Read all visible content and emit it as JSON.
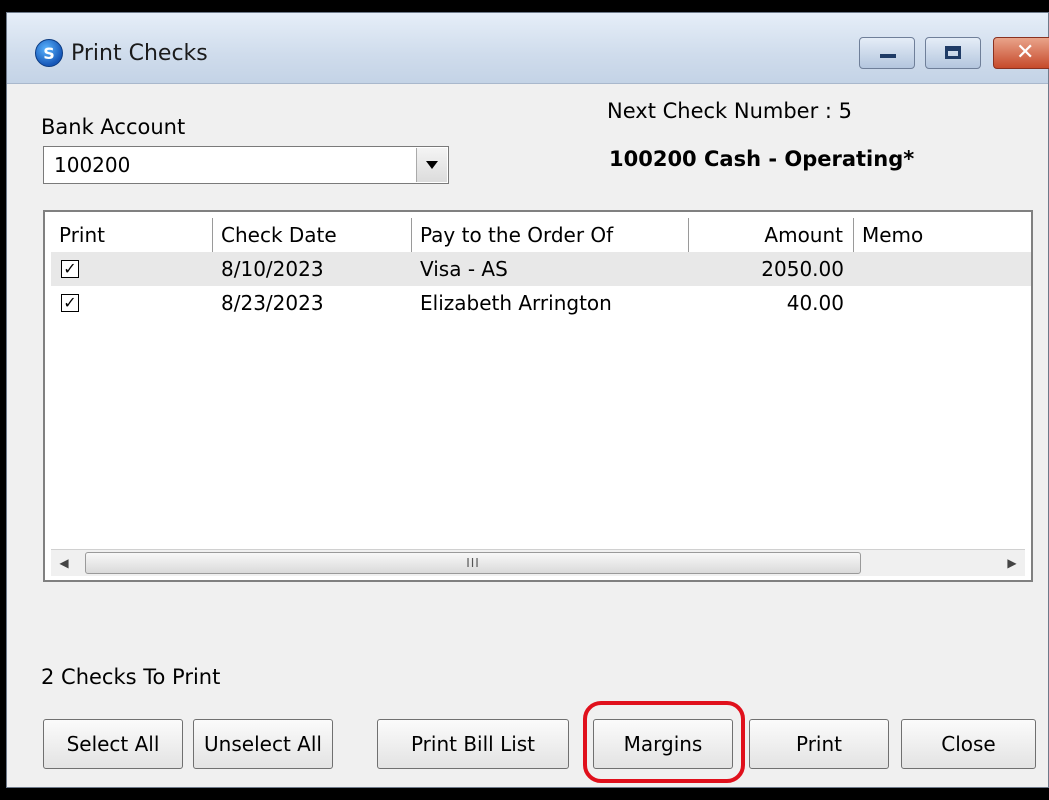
{
  "window": {
    "title": "Print Checks",
    "app_icon_letter": "S",
    "controls": {
      "minimize": "minimize",
      "maximize": "maximize",
      "close": "✕"
    }
  },
  "bank_account": {
    "label": "Bank Account",
    "selected": "100200",
    "next_check_number": "Next Check Number : 5",
    "account_name": "100200 Cash - Operating*"
  },
  "grid": {
    "columns": [
      "Print",
      "Check Date",
      "Pay to the Order Of",
      "Amount",
      "Memo"
    ],
    "rows": [
      {
        "print": true,
        "check_date": "8/10/2023",
        "payee": "Visa - AS",
        "amount": "2050.00",
        "memo": ""
      },
      {
        "print": true,
        "check_date": "8/23/2023",
        "payee": "Elizabeth Arrington",
        "amount": "40.00",
        "memo": ""
      }
    ],
    "scroll_thumb_grip": "III",
    "check_glyph": "✓"
  },
  "status": {
    "checks_to_print": "2 Checks To Print"
  },
  "buttons": {
    "select_all": "Select All",
    "unselect_all": "Unselect All",
    "print_bill_list": "Print Bill List",
    "margins": "Margins",
    "print": "Print",
    "close": "Close"
  },
  "colors": {
    "highlight": "#e0101c",
    "titlebar": "#cfdcec"
  }
}
